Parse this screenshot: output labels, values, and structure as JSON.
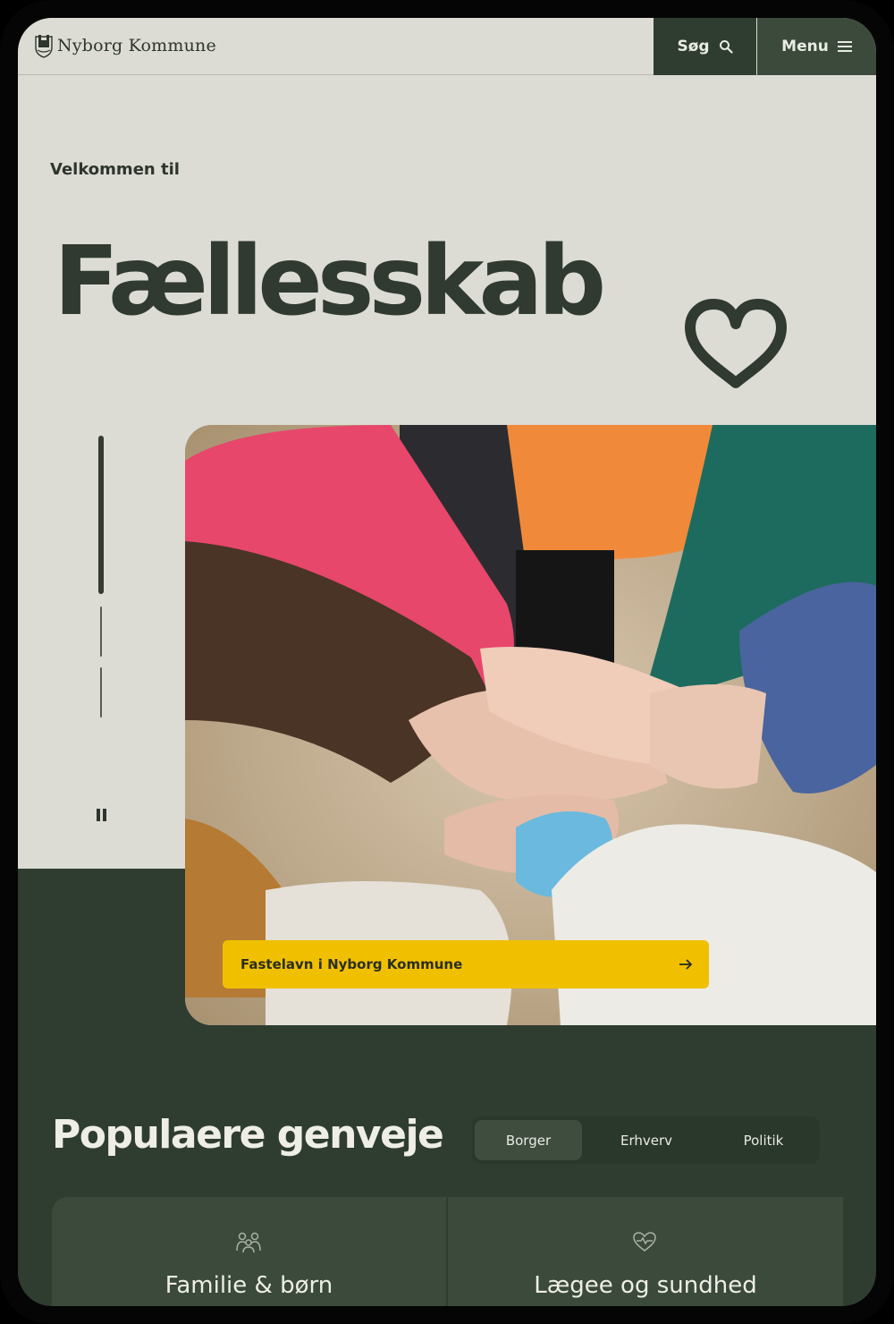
{
  "header": {
    "logo_text": "Nyborg Kommune",
    "search_label": "Søg",
    "menu_label": "Menu"
  },
  "hero": {
    "welcome": "Velkommen til",
    "title": "Fællesskab",
    "slides_total": 3,
    "active_slide": 1,
    "cta_label": "Fastelavn i Nyborg Kommune"
  },
  "shortcuts": {
    "title": "Populaere genveje",
    "tabs": [
      {
        "label": "Borger",
        "active": true
      },
      {
        "label": "Erhverv",
        "active": false
      },
      {
        "label": "Politik",
        "active": false
      }
    ],
    "cards": [
      {
        "label": "Familie & børn",
        "icon": "family-icon"
      },
      {
        "label": "Lægee og sundhed",
        "icon": "heart-pulse-icon"
      }
    ]
  },
  "colors": {
    "dark_green": "#2f3d30",
    "light_bg": "#dcdcd5",
    "accent_yellow": "#f0c000"
  }
}
